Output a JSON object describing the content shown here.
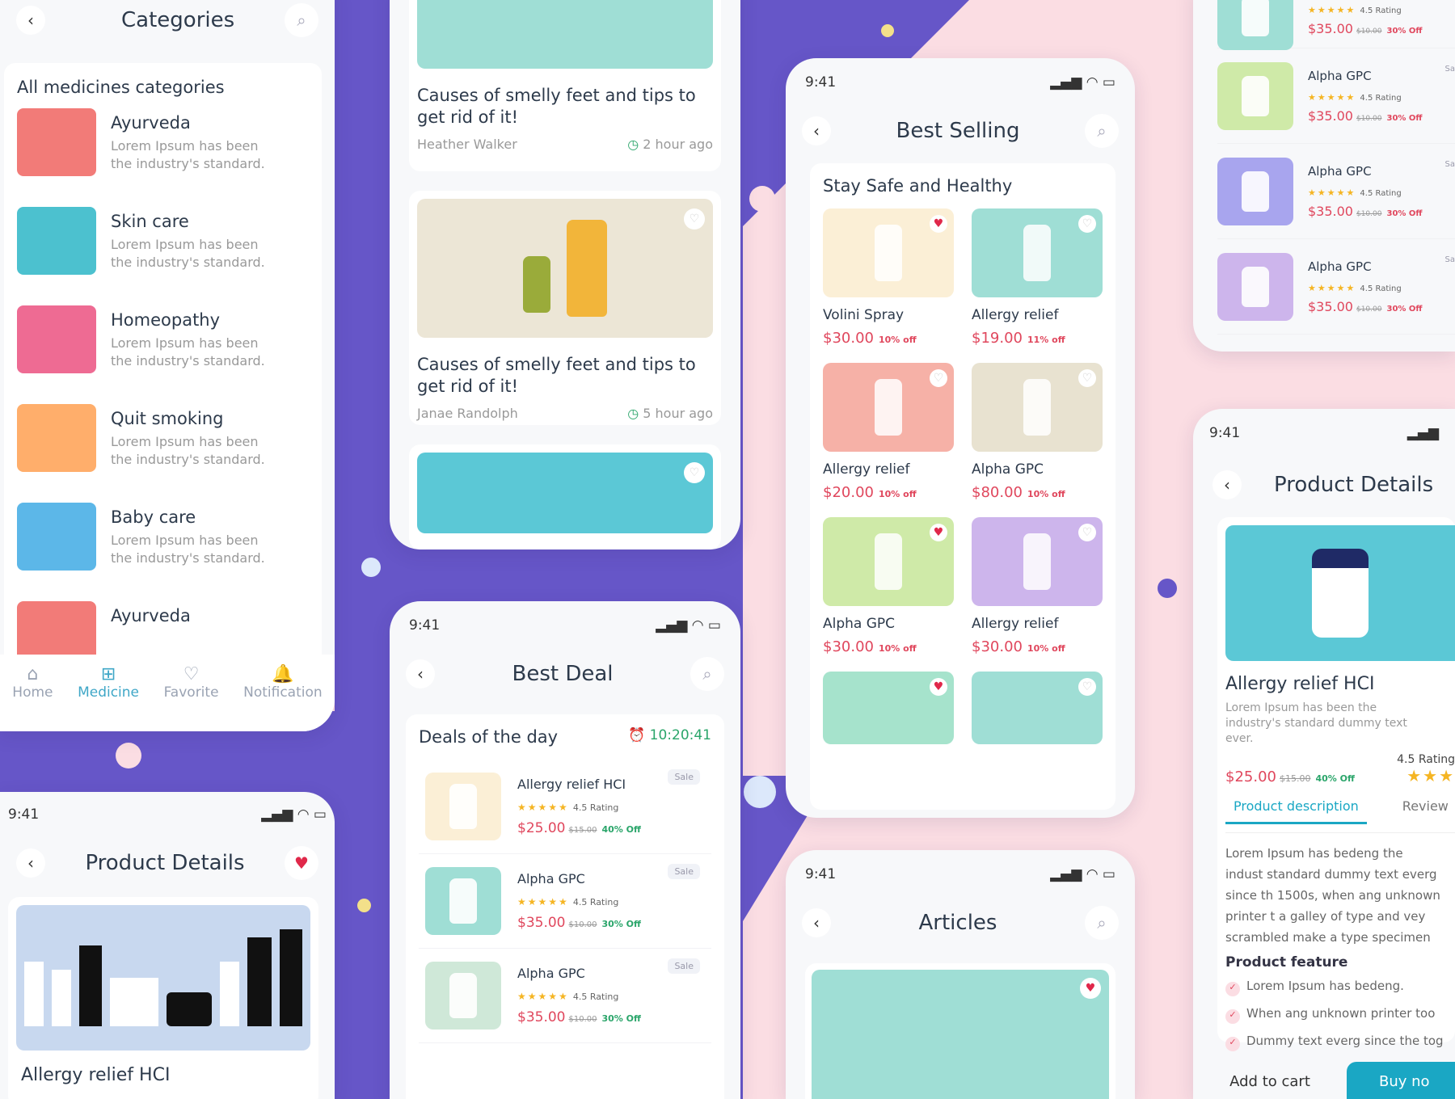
{
  "cats": {
    "title": "Categories",
    "section": "All medicines categories",
    "items": [
      {
        "name": "Ayurveda",
        "desc": "Lorem Ipsum has been the industry's standard."
      },
      {
        "name": "Skin care",
        "desc": "Lorem Ipsum has been the industry's standard."
      },
      {
        "name": "Homeopathy",
        "desc": "Lorem Ipsum has been the industry's standard."
      },
      {
        "name": "Quit smoking",
        "desc": "Lorem Ipsum has been the industry's standard."
      },
      {
        "name": "Baby care",
        "desc": "Lorem Ipsum has been the industry's standard."
      },
      {
        "name": "Ayurveda",
        "desc": ""
      }
    ],
    "nav": [
      "Home",
      "Medicine",
      "Favorite",
      "Notification"
    ]
  },
  "feed": {
    "articles": [
      {
        "title": "Causes of smelly feet and tips to get rid of it!",
        "author": "Heather Walker",
        "time": "2 hour ago"
      },
      {
        "title": "Causes of smelly feet and tips to get rid of it!",
        "author": "Janae Randolph",
        "time": "5 hour ago"
      }
    ]
  },
  "bestsell": {
    "time": "9:41",
    "title": "Best Selling",
    "section": "Stay Safe and Healthy",
    "items": [
      {
        "name": "Volini Spray",
        "price": "$30.00",
        "off": "10% off"
      },
      {
        "name": "Allergy relief",
        "price": "$19.00",
        "off": "11% off"
      },
      {
        "name": "Allergy relief",
        "price": "$20.00",
        "off": "10% off"
      },
      {
        "name": "Alpha GPC",
        "price": "$80.00",
        "off": "10% off"
      },
      {
        "name": "Alpha GPC",
        "price": "$30.00",
        "off": "10% off"
      },
      {
        "name": "Allergy relief",
        "price": "$30.00",
        "off": "10% off"
      }
    ]
  },
  "rightlist": {
    "items": [
      {
        "name": "",
        "rating": "4.5 Rating",
        "price": "$35.00",
        "old": "$10.00",
        "off": "30% Off"
      },
      {
        "name": "Alpha GPC",
        "rating": "4.5 Rating",
        "price": "$35.00",
        "old": "$10.00",
        "off": "30% Off",
        "sale": "Sa"
      },
      {
        "name": "Alpha GPC",
        "rating": "4.5 Rating",
        "price": "$35.00",
        "old": "$10.00",
        "off": "30% Off",
        "sale": "Sa"
      },
      {
        "name": "Alpha GPC",
        "rating": "4.5 Rating",
        "price": "$35.00",
        "old": "$10.00",
        "off": "30% Off",
        "sale": "Sa"
      }
    ]
  },
  "pdright": {
    "time": "9:41",
    "title": "Product Details",
    "name": "Allergy relief HCI",
    "desc": "Lorem Ipsum has been the industry's standard dummy text ever.",
    "price": "$25.00",
    "old": "$15.00",
    "off": "40% Off",
    "rating": "4.5 Rating",
    "tab1": "Product description",
    "tab2": "Review",
    "body": "Lorem Ipsum has bedeng the indust standard dummy text everg since th 1500s, when ang unknown printer t a galley of type and vey scrambled make a type specimen book.",
    "feature_title": "Product feature",
    "features": [
      "Lorem Ipsum has bedeng.",
      "When ang unknown printer too",
      "Dummy text everg since the tog"
    ],
    "cart": "Add to cart",
    "buy": "Buy no"
  },
  "pdleft": {
    "time": "9:41",
    "title": "Product Details",
    "name": "Allergy relief HCI"
  },
  "deal": {
    "time": "9:41",
    "title": "Best Deal",
    "section": "Deals of the day",
    "timer": "10:20:41",
    "items": [
      {
        "name": "Allergy relief HCI",
        "rating": "4.5 Rating",
        "price": "$25.00",
        "old": "$15.00",
        "off": "40% Off",
        "sale": "Sale"
      },
      {
        "name": "Alpha GPC",
        "rating": "4.5 Rating",
        "price": "$35.00",
        "old": "$10.00",
        "off": "30% Off",
        "sale": "Sale"
      },
      {
        "name": "Alpha GPC",
        "rating": "4.5 Rating",
        "price": "$35.00",
        "old": "$10.00",
        "off": "30% Off",
        "sale": "Sale"
      }
    ]
  },
  "articles": {
    "time": "9:41",
    "title": "Articles"
  },
  "colors": {
    "accent": "#1aa7c4",
    "price": "#e0475d",
    "purple": "#6656c8",
    "pink": "#fbdde3"
  }
}
